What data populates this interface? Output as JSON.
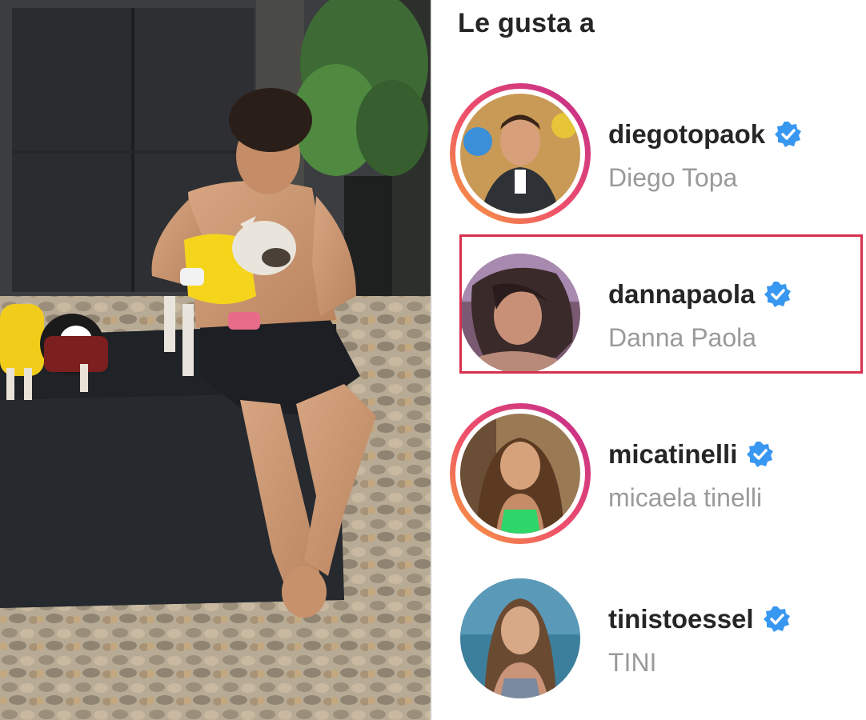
{
  "likes_panel": {
    "title": "Le gusta a",
    "users": [
      {
        "username": "diegotopaok",
        "full_name": "Diego Topa",
        "verified": true,
        "story_ring": true,
        "highlighted": false,
        "avatar_bg": "#c99a55",
        "shirt_color": "#2e3236"
      },
      {
        "username": "dannapaola",
        "full_name": "Danna Paola",
        "verified": true,
        "story_ring": false,
        "highlighted": true,
        "avatar_bg": "#7a5a72",
        "shirt_color": "#3a2a2a"
      },
      {
        "username": "micatinelli",
        "full_name": "micaela tinelli",
        "verified": true,
        "story_ring": true,
        "highlighted": false,
        "avatar_bg": "#9a7a55",
        "shirt_color": "#2fd66a"
      },
      {
        "username": "tinistoessel",
        "full_name": "TINI",
        "verified": true,
        "story_ring": false,
        "highlighted": false,
        "avatar_bg": "#3c7f9c",
        "shirt_color": "#7a8aa0"
      }
    ]
  },
  "colors": {
    "verified_blue": "#3897f0",
    "highlight_red": "#d7304f",
    "text_primary": "#262626",
    "text_secondary": "#9a9a9a"
  },
  "icons": {
    "verified": "verified-check-icon"
  }
}
